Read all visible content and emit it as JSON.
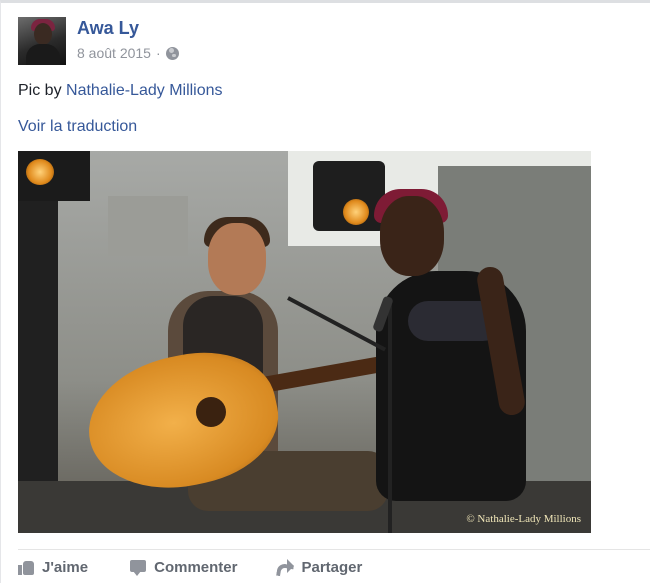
{
  "post": {
    "author": "Awa Ly",
    "date": "8 août 2015",
    "separator": "·",
    "text_prefix": "Pic by ",
    "text_link": "Nathalie-Lady Millions",
    "translate": "Voir la traduction",
    "photo_credit": "© Nathalie-Lady Millions",
    "audience_icon": "globe-icon"
  },
  "actions": {
    "like": "J'aime",
    "comment": "Commenter",
    "share": "Partager"
  },
  "colors": {
    "link": "#365899",
    "muted": "#90949c",
    "action_text": "#616770"
  }
}
